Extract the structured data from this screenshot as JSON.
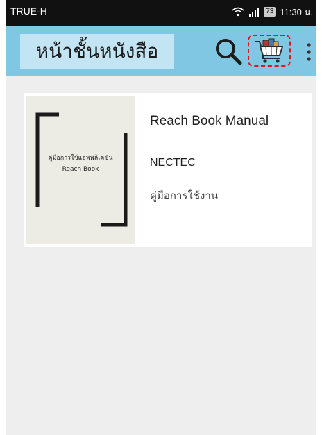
{
  "status_bar": {
    "carrier": "TRUE-H",
    "battery": "73",
    "time": "11:30 น."
  },
  "app_bar": {
    "title": "หน้าชั้นหนังสือ",
    "icons": {
      "search": "search-icon",
      "cart": "cart-icon",
      "more": "more-vert-icon"
    },
    "highlight_color": "#e01515",
    "bar_color": "#7fc7e3"
  },
  "books": [
    {
      "cover_line1": "คู่มือการใช้แอพพลิเคชัน",
      "cover_line2": "Reach Book",
      "title": "Reach Book Manual",
      "author": "NECTEC",
      "description": "คู่มือการใช้งาน"
    }
  ]
}
